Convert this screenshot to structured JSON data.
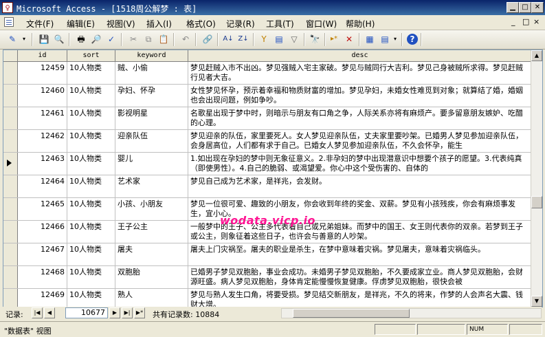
{
  "window": {
    "title": "Microsoft Access - [1518周公解梦 : 表]",
    "app_icon": "access-key-icon",
    "minimize": "minimize-icon",
    "maximize": "maximize-icon",
    "close": "close-icon"
  },
  "menu": {
    "items": [
      "文件(F)",
      "编辑(E)",
      "视图(V)",
      "插入(I)",
      "格式(O)",
      "记录(R)",
      "工具(T)",
      "窗口(W)",
      "帮助(H)"
    ],
    "doc_icon": "datasheet-icon",
    "doc_controls": [
      "_",
      "□",
      "×"
    ]
  },
  "toolbar": {
    "icons": [
      "design-view-icon",
      "save-icon",
      "search-icon",
      "print-icon",
      "print-preview-icon",
      "spelling-icon",
      "cut-icon",
      "copy-icon",
      "paste-icon",
      "undo-icon",
      "hyperlink-icon",
      "sort-ascending-icon",
      "sort-descending-icon",
      "filter-by-selection-icon",
      "filter-by-form-icon",
      "apply-filter-icon",
      "find-icon",
      "new-record-icon",
      "delete-record-icon",
      "database-window-icon",
      "new-object-icon",
      "help-icon"
    ],
    "glyphs": [
      "✎",
      "💾",
      "🔍",
      "🖶",
      "🔎",
      "✓",
      "✂",
      "⧉",
      "📋",
      "↶",
      "🔗",
      "A↓",
      "Z↓",
      "Y",
      "▤",
      "▽",
      "🔭",
      "▸*",
      "✕",
      "▦",
      "▤",
      "?"
    ]
  },
  "columns": [
    {
      "name": "id"
    },
    {
      "name": "sort"
    },
    {
      "name": "keyword"
    },
    {
      "name": "desc"
    }
  ],
  "rows": [
    {
      "id": "12459",
      "sort": "10人物类",
      "keyword": "贼、小偷",
      "desc": "梦见赶贼入市不出凶。梦见强贼入宅主家破。梦见与贼同行大吉利。梦见己身被贼所求得。梦见赶贼行见者大吉。"
    },
    {
      "id": "12460",
      "sort": "10人物类",
      "keyword": "孕妇、怀孕",
      "desc": "女性梦见怀孕，预示着幸福和物质财富的增加。梦见孕妇，未婚女性难觅到对象；就算结了婚，婚姻也会出现问题，例如争吵。"
    },
    {
      "id": "12461",
      "sort": "10人物类",
      "keyword": "影视明星",
      "desc": "名歌星出现于梦中时，则暗示与朋友有口角之争，人际关系亦将有麻烦产。要多留意朋友嫉妒、吃醋的心理。"
    },
    {
      "id": "12462",
      "sort": "10人物类",
      "keyword": "迎亲队伍",
      "desc": "梦见迎亲的队伍，家里要死人。女人梦见迎亲队伍，丈夫家里要吵架。已婚男人梦见参加迎亲队伍，会身居高位，人们都有求于自己。已婚女人梦见参加迎亲队伍，不久会怀孕，能生"
    },
    {
      "id": "12463",
      "sort": "10人物类",
      "keyword": "婴儿",
      "desc": "1.如出现在孕妇的梦中则无象征意义。2.非孕妇的梦中出现潜意识中想要个孩子的愿望。3.代表纯真（即使男性）。4.自己的脆弱、或渴望爱。你心中这个受伤害的、自体的"
    },
    {
      "id": "12464",
      "sort": "10人物类",
      "keyword": "艺术家",
      "desc": "梦见自己成为艺术家，是祥兆，会发财。"
    },
    {
      "id": "12465",
      "sort": "10人物类",
      "keyword": "小孩、小朋友",
      "desc": "梦见一位很可爱、趣致的小朋友，你会收到年终的奖金、双薪。梦见有小孩残疾，你会有麻烦事发生，宜小心。"
    },
    {
      "id": "12466",
      "sort": "10人物类",
      "keyword": "王子公主",
      "desc": "一般梦中的王子、公主多代表着自己或兄弟姐妹。而梦中的国王、女王则代表你的双亲。若梦到王子或公主，则象征着这些日子，也许会与善意的人吵架。"
    },
    {
      "id": "12467",
      "sort": "10人物类",
      "keyword": "屠夫",
      "desc": "屠夫上门灾祸至。屠夫的职业是杀生，在梦中意味着灾祸。梦见屠夫，意味着灾祸临头。"
    },
    {
      "id": "12468",
      "sort": "10人物类",
      "keyword": "双胞胎",
      "desc": "已婚男子梦见双胞胎，事业会成功。未婚男子梦见双胞胎，不久要成家立业。商人梦见双胞胎，会财源旺盛。病人梦见双胞胎，身体肯定能慢慢恢复健康。俘虏梦见双胞胎，很快会被"
    },
    {
      "id": "12469",
      "sort": "10人物类",
      "keyword": "熟人",
      "desc": "梦见与熟人发生口角，将要受损。梦见结交新朋友，是祥兆，不久的将来，作梦的人会声名大震、钱财大增。"
    }
  ],
  "current_row_index": 4,
  "watermark": "wodata.vicp.io",
  "nav": {
    "label": "记录:",
    "current_record": "10677",
    "total_label": "共有记录数: 10884",
    "buttons": [
      "|◀",
      "◀",
      "▶",
      "▶|",
      "▶*"
    ]
  },
  "status": {
    "text": "\"数据表\" 视图",
    "num": "NUM"
  }
}
